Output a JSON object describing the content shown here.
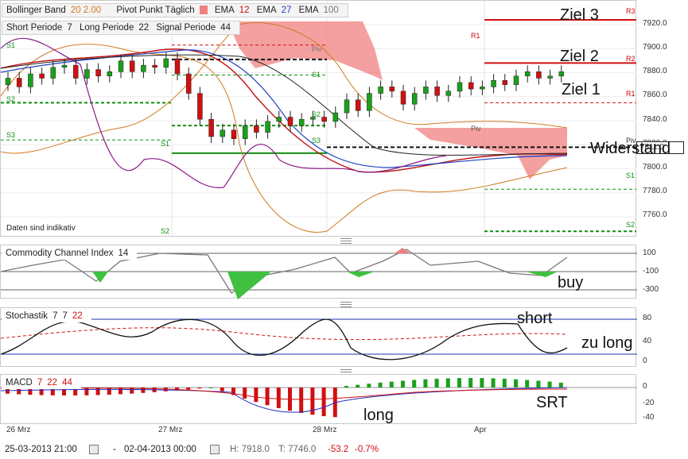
{
  "main_legend": {
    "bollinger_label": "Bollinger Band",
    "bollinger_params": "20  2.00",
    "pivot_label": "Pivot Punkt  Täglich",
    "ema1_label": "EMA",
    "ema1_val": "12",
    "ema2_label": "EMA",
    "ema2_val": "27",
    "ema3_label": "EMA",
    "ema3_val": "100",
    "short_label": "Short Periode",
    "short_val": "7",
    "long_label": "Long Periode",
    "long_val": "22",
    "signal_label": "Signal Periode",
    "signal_val": "44"
  },
  "price_axis": [
    "7920.0",
    "7900.0",
    "7880.0",
    "7860.0",
    "7840.0",
    "7820.0",
    "7800.0",
    "7780.0",
    "7760.0"
  ],
  "current_price": "7811.0",
  "pivot_labels": {
    "left": [
      "Piv",
      "S1",
      "S2",
      "S3",
      "S1",
      "S2",
      "S3",
      "S1",
      "S2"
    ],
    "right": [
      "R3",
      "R2",
      "R1",
      "Piv",
      "S1",
      "S2",
      "R1",
      "Piv",
      "Piv",
      "S1",
      "S2"
    ]
  },
  "data_note": "Daten sind indikativ",
  "annotations": {
    "ziel3": "Ziel 3",
    "ziel2": "Ziel 2",
    "ziel1": "Ziel 1",
    "widerstand": "Widerstand",
    "buy": "buy",
    "short": "short",
    "zu_long": "zu long",
    "long": "long",
    "srt": "SRT"
  },
  "cci": {
    "label": "Commodity Channel Index",
    "param": "14",
    "axis": [
      "100",
      "-100",
      "-300"
    ]
  },
  "stoch": {
    "label": "Stochastik",
    "p1": "7",
    "p2": "7",
    "p3": "22",
    "axis": [
      "80",
      "40",
      "0"
    ]
  },
  "macd": {
    "label": "MACD",
    "p1": "7",
    "p2": "22",
    "p3": "44",
    "axis": [
      "0",
      "-20",
      "-40"
    ]
  },
  "date_axis": [
    "26 Mrz",
    "27 Mrz",
    "28 Mrz",
    "Apr"
  ],
  "footer": {
    "start": "25-03-2013 21:00",
    "dash": "-",
    "end": "02-04-2013 00:00",
    "high": "H: 7918.0",
    "low": "T: 7746.0",
    "change": "-53.2",
    "change_pct": "-0.7%"
  },
  "colors": {
    "bull": "#1aa01a",
    "bear": "#d01010",
    "cloud": "#f08080",
    "bollinger": "#d07a20",
    "ema12": "#c01010",
    "ema27": "#2040c0",
    "ema100": "#777777"
  },
  "chart_data": {
    "type": "candlestick",
    "price_range": [
      7745,
      7925
    ],
    "indicators": [
      "Bollinger Band (20, 2.00)",
      "Pivot Punkt Täglich",
      "EMA 12",
      "EMA 27",
      "EMA 100"
    ],
    "pivot_levels": {
      "R3": 7924,
      "R2": 7888,
      "R1": 7855,
      "Piv": 7818,
      "S1": 7783,
      "S2": 7748
    },
    "high": 7918.0,
    "low": 7746.0,
    "change": -53.2,
    "change_pct": -0.7,
    "cci_levels": [
      100,
      -100,
      -300
    ],
    "stochastic_levels": [
      80,
      40,
      0
    ],
    "macd_axis": [
      0,
      -20,
      -40
    ]
  }
}
